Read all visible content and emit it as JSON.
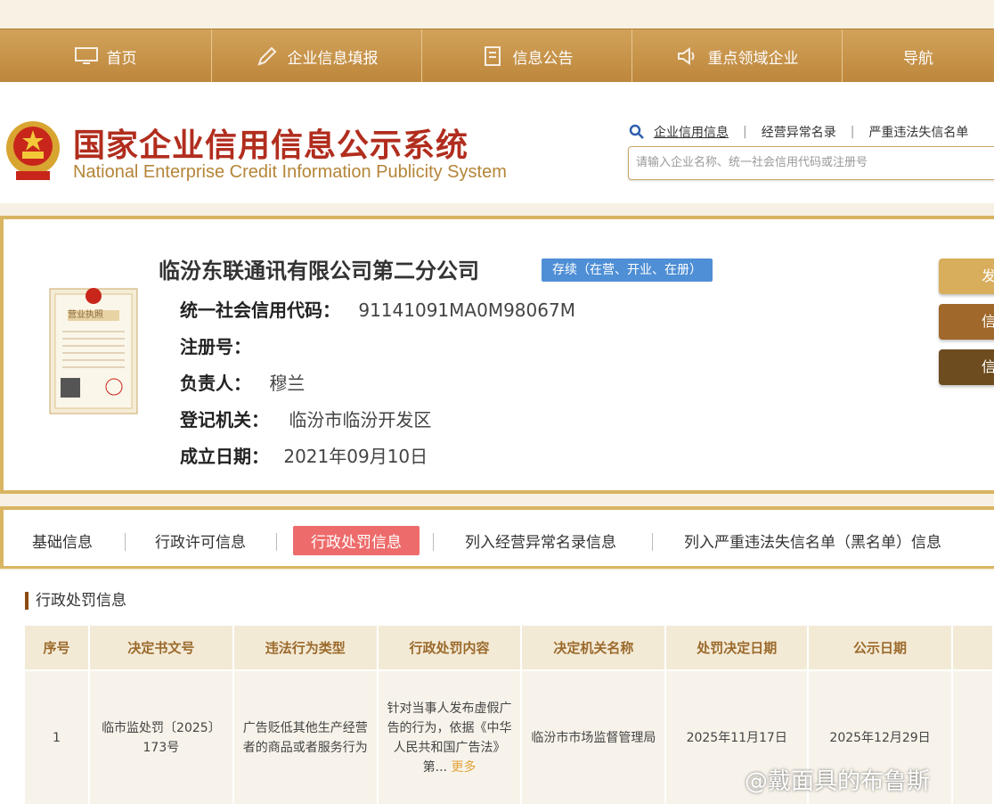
{
  "nav": {
    "items": [
      {
        "label": "首页",
        "icon": "monitor-icon"
      },
      {
        "label": "企业信息填报",
        "icon": "pen-icon"
      },
      {
        "label": "信息公告",
        "icon": "document-icon"
      },
      {
        "label": "重点领域企业",
        "icon": "speaker-icon"
      },
      {
        "label": "导航",
        "icon": ""
      }
    ]
  },
  "header": {
    "title_cn": "国家企业信用信息公示系统",
    "title_en": "National Enterprise Credit Information Publicity System",
    "search_links": [
      "企业信用信息",
      "经营异常名录",
      "严重违法失信名单"
    ],
    "search_placeholder": "请输入企业名称、统一社会信用代码或注册号"
  },
  "company": {
    "name": "临汾东联通讯有限公司第二分公司",
    "status": "存续（在营、开业、在册）",
    "license_label": "营业执照",
    "fields": [
      {
        "label": "统一社会信用代码：",
        "value": "91141091MA0M98067M"
      },
      {
        "label": "注册号：",
        "value": ""
      },
      {
        "label": "负责人：",
        "value": "穆兰"
      },
      {
        "label": "登记机关：",
        "value": "临汾市临汾开发区"
      },
      {
        "label": "成立日期：",
        "value": "2021年09月10日"
      }
    ],
    "side_buttons": [
      {
        "label": "发",
        "color": "#d8ad5c"
      },
      {
        "label": "信",
        "color": "#a0682b"
      },
      {
        "label": "信",
        "color": "#6d4c1f"
      }
    ]
  },
  "tabs": {
    "items": [
      "基础信息",
      "行政许可信息",
      "行政处罚信息",
      "列入经营异常名录信息",
      "列入严重违法失信名单（黑名单）信息"
    ],
    "active_index": 2
  },
  "penalty": {
    "title": "行政处罚信息",
    "columns": [
      "序号",
      "决定书文号",
      "违法行为类型",
      "行政处罚内容",
      "决定机关名称",
      "处罚决定日期",
      "公示日期"
    ],
    "rows": [
      {
        "index": "1",
        "doc_no": "临市监处罚〔2025〕173号",
        "violation": "广告贬低其他生产经营者的商品或者服务行为",
        "content": "针对当事人发布虚假广告的行为，依据《中华人民共和国广告法》第...",
        "more": "更多",
        "authority": "临汾市市场监督管理局",
        "decision_date": "2025年11月17日",
        "publish_date": "2025年12月29日"
      }
    ]
  },
  "watermark": "@戴面具的布鲁斯",
  "colors": {
    "nav_gold": "#c8964b",
    "title_red": "#b12d1e",
    "status_blue": "#4f8fd6",
    "active_tab": "#ee6b6b",
    "border_gold": "#d9b463"
  }
}
